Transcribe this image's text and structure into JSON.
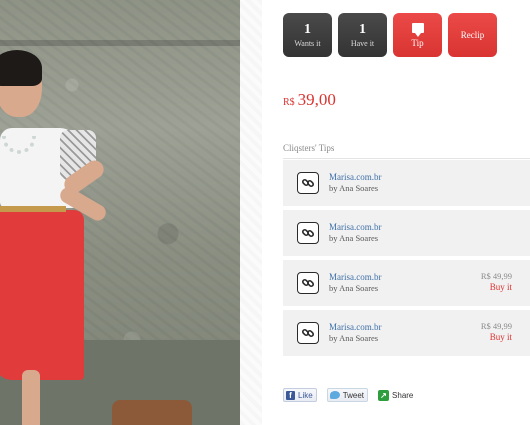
{
  "actions": {
    "wants": {
      "count": "1",
      "label": "Wants it"
    },
    "have": {
      "count": "1",
      "label": "Have it"
    },
    "tip": {
      "label": "Tip"
    },
    "reclip": {
      "label": "Reclip"
    }
  },
  "product": {
    "currency": "R$",
    "price": "39,00"
  },
  "tips_section": {
    "title": "Cliqsters' Tips",
    "items": [
      {
        "store": "Marisa.com.br",
        "by": "by Ana Soares",
        "price": "",
        "buy": ""
      },
      {
        "store": "Marisa.com.br",
        "by": "by Ana Soares",
        "price": "",
        "buy": ""
      },
      {
        "store": "Marisa.com.br",
        "by": "by Ana Soares",
        "price": "R$ 49,99",
        "buy": "Buy it"
      },
      {
        "store": "Marisa.com.br",
        "by": "by Ana Soares",
        "price": "R$ 49,99",
        "buy": "Buy it"
      }
    ]
  },
  "social": {
    "like": "Like",
    "tweet": "Tweet",
    "share": "Share"
  },
  "colors": {
    "accent": "#d93431",
    "dark_button": "#3d3d3d",
    "link": "#3c6fa8"
  }
}
